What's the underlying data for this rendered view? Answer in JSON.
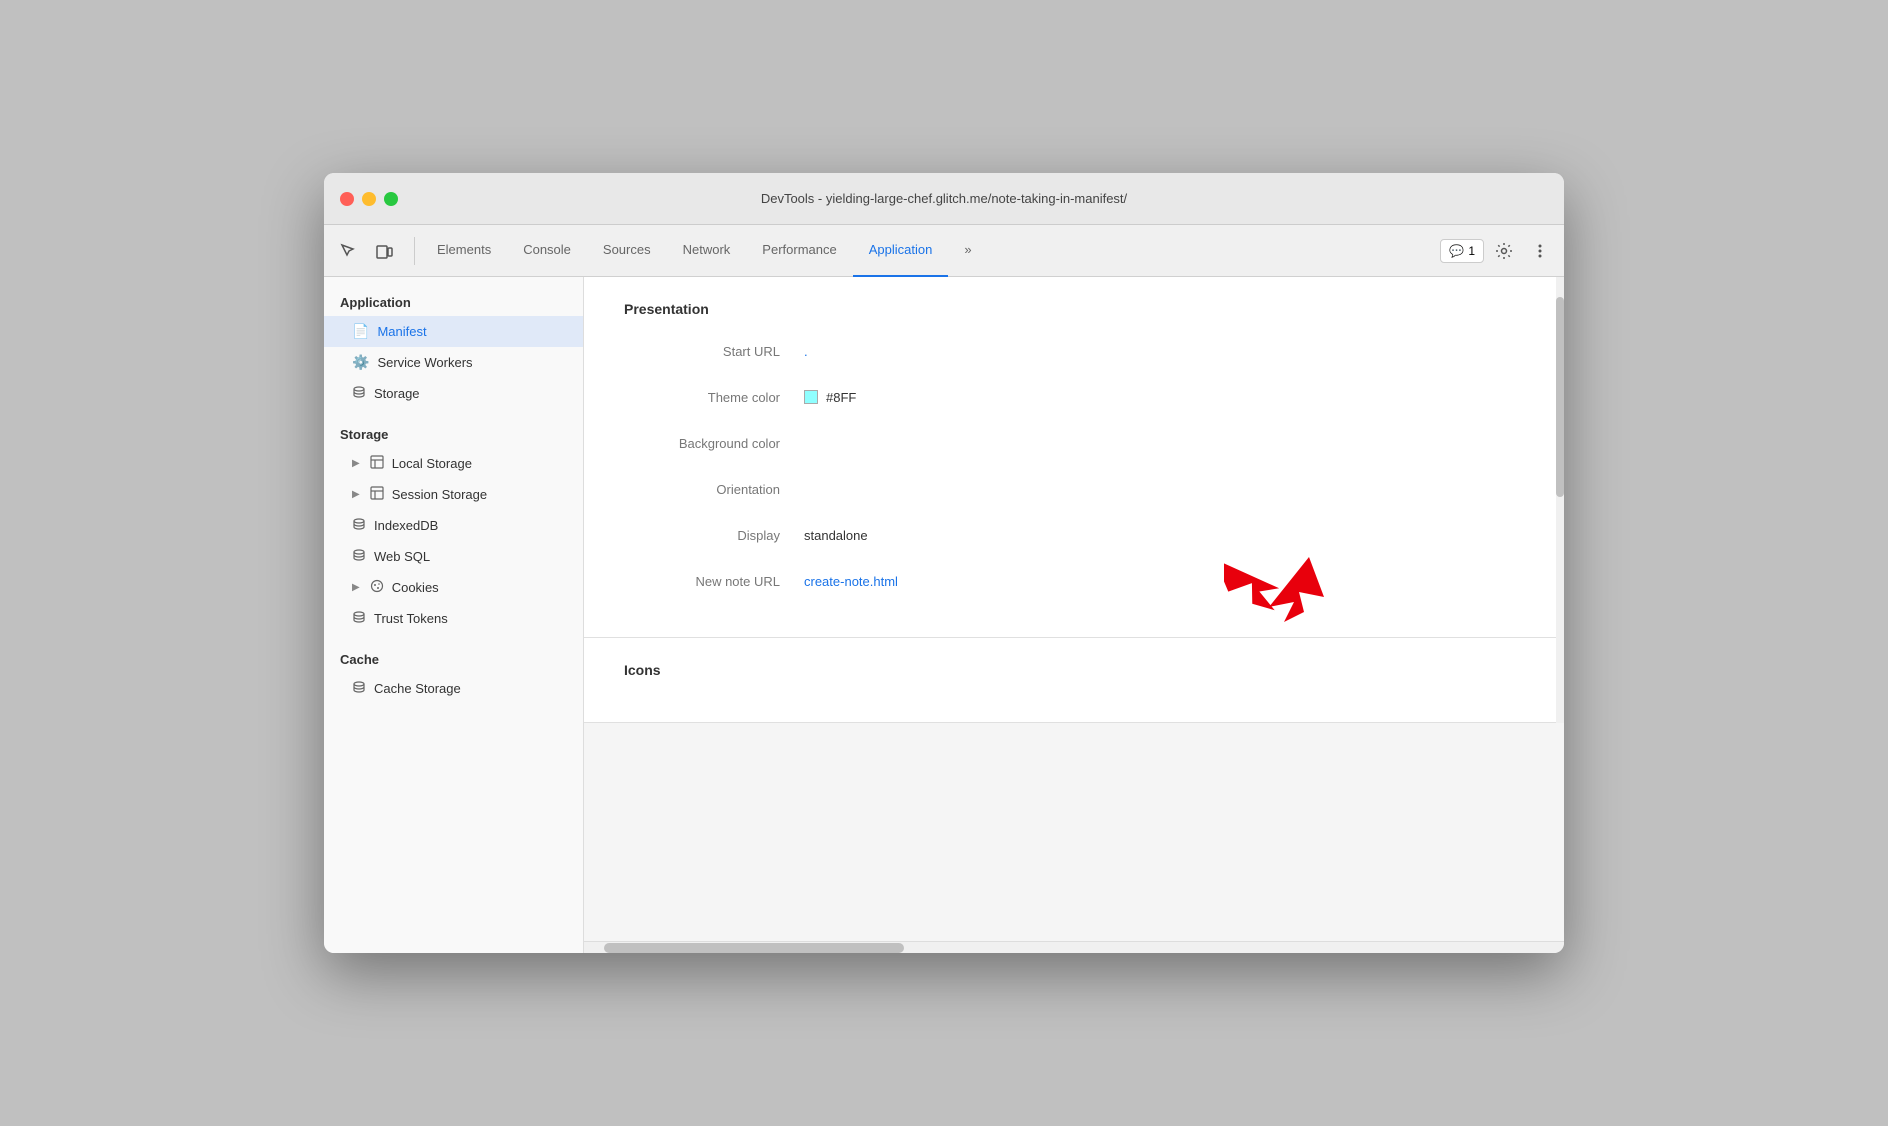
{
  "window": {
    "title": "DevTools - yielding-large-chef.glitch.me/note-taking-in-manifest/"
  },
  "toolbar": {
    "tabs": [
      {
        "id": "elements",
        "label": "Elements",
        "active": false
      },
      {
        "id": "console",
        "label": "Console",
        "active": false
      },
      {
        "id": "sources",
        "label": "Sources",
        "active": false
      },
      {
        "id": "network",
        "label": "Network",
        "active": false
      },
      {
        "id": "performance",
        "label": "Performance",
        "active": false
      },
      {
        "id": "application",
        "label": "Application",
        "active": true
      }
    ],
    "notification_count": "1",
    "more_tabs_label": "»"
  },
  "sidebar": {
    "application_section": "Application",
    "items_application": [
      {
        "id": "manifest",
        "label": "Manifest",
        "icon": "📄",
        "active": true
      },
      {
        "id": "service-workers",
        "label": "Service Workers",
        "icon": "⚙️",
        "active": false
      },
      {
        "id": "storage",
        "label": "Storage",
        "icon": "🗄️",
        "active": false
      }
    ],
    "storage_section": "Storage",
    "items_storage": [
      {
        "id": "local-storage",
        "label": "Local Storage",
        "icon": "▦",
        "hasArrow": true
      },
      {
        "id": "session-storage",
        "label": "Session Storage",
        "icon": "▦",
        "hasArrow": true
      },
      {
        "id": "indexeddb",
        "label": "IndexedDB",
        "icon": "🗄️",
        "hasArrow": false
      },
      {
        "id": "web-sql",
        "label": "Web SQL",
        "icon": "🗄️",
        "hasArrow": false
      },
      {
        "id": "cookies",
        "label": "Cookies",
        "icon": "🍪",
        "hasArrow": true
      },
      {
        "id": "trust-tokens",
        "label": "Trust Tokens",
        "icon": "🗄️",
        "hasArrow": false
      }
    ],
    "cache_section": "Cache",
    "items_cache": [
      {
        "id": "cache-storage",
        "label": "Cache Storage",
        "icon": "🗄️",
        "hasArrow": false
      }
    ]
  },
  "content": {
    "presentation_title": "Presentation",
    "properties": [
      {
        "label": "Start URL",
        "value": ".",
        "type": "link",
        "id": "start-url"
      },
      {
        "label": "Theme color",
        "value": "#8FF",
        "type": "color",
        "color": "#8fffff",
        "id": "theme-color"
      },
      {
        "label": "Background color",
        "value": "",
        "type": "text",
        "id": "bg-color"
      },
      {
        "label": "Orientation",
        "value": "",
        "type": "text",
        "id": "orientation"
      },
      {
        "label": "Display",
        "value": "standalone",
        "type": "text",
        "id": "display"
      },
      {
        "label": "New note URL",
        "value": "create-note.html",
        "type": "link",
        "id": "new-note-url"
      }
    ],
    "icons_title": "Icons"
  }
}
